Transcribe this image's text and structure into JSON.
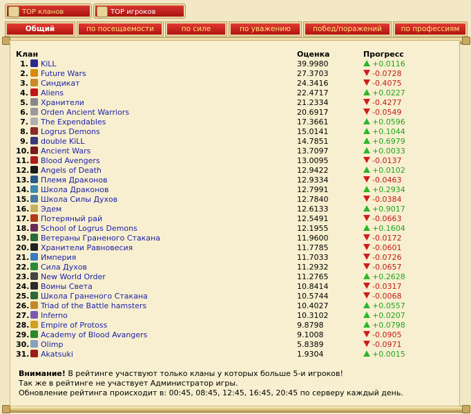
{
  "top_tabs": [
    {
      "label": "TOP кланов",
      "active": true
    },
    {
      "label": "TOP игроков",
      "active": false
    }
  ],
  "sub_tabs": [
    {
      "label": "Общий",
      "active": true
    },
    {
      "label": "по посещаемости",
      "active": false
    },
    {
      "label": "по силе",
      "active": false
    },
    {
      "label": "по уважению",
      "active": false
    },
    {
      "label": "побед/поражений",
      "active": false
    },
    {
      "label": "по профессиям",
      "active": false
    }
  ],
  "table": {
    "headers": {
      "clan": "Клан",
      "score": "Оценка",
      "progress": "Прогресс"
    },
    "rows": [
      {
        "rank": "1.",
        "name": "KiLL",
        "score": "39.9980",
        "progress": "+0.0116",
        "dir": "up",
        "icon_color": "#2b2b8f"
      },
      {
        "rank": "2.",
        "name": "Future Wars",
        "score": "27.3703",
        "progress": "-0.0728",
        "dir": "down",
        "icon_color": "#d98a10"
      },
      {
        "rank": "3.",
        "name": "Синдикат",
        "score": "24.3416",
        "progress": "-0.4075",
        "dir": "down",
        "icon_color": "#c98a2a"
      },
      {
        "rank": "4.",
        "name": "Aliens",
        "score": "22.4717",
        "progress": "+0.0227",
        "dir": "up",
        "icon_color": "#c01818"
      },
      {
        "rank": "5.",
        "name": "Хранители",
        "score": "21.2334",
        "progress": "-0.4277",
        "dir": "down",
        "icon_color": "#888888"
      },
      {
        "rank": "6.",
        "name": "Orden Ancient Warriors",
        "score": "20.6917",
        "progress": "-0.0549",
        "dir": "down",
        "icon_color": "#9a9a9a"
      },
      {
        "rank": "7.",
        "name": "The Expendables",
        "score": "17.3661",
        "progress": "+0.0596",
        "dir": "up",
        "icon_color": "#b0b0b0"
      },
      {
        "rank": "8.",
        "name": "Logrus Demons",
        "score": "15.0141",
        "progress": "+0.1044",
        "dir": "up",
        "icon_color": "#8a2a2a"
      },
      {
        "rank": "9.",
        "name": "double KiLL",
        "score": "14.7851",
        "progress": "+0.6979",
        "dir": "up",
        "icon_color": "#3a3a7a"
      },
      {
        "rank": "10.",
        "name": "Ancient Wars",
        "score": "13.7097",
        "progress": "+0.0033",
        "dir": "up",
        "icon_color": "#7a1a1a"
      },
      {
        "rank": "11.",
        "name": "Blood Avengers",
        "score": "13.0095",
        "progress": "-0.0137",
        "dir": "down",
        "icon_color": "#b01c1c"
      },
      {
        "rank": "12.",
        "name": "Angels of Death",
        "score": "12.9422",
        "progress": "+0.0102",
        "dir": "up",
        "icon_color": "#1a1a1a"
      },
      {
        "rank": "13.",
        "name": "Племя Драконов",
        "score": "12.9334",
        "progress": "-0.0463",
        "dir": "down",
        "icon_color": "#2a5a8a"
      },
      {
        "rank": "14.",
        "name": "Школа Драконов",
        "score": "12.7991",
        "progress": "+0.2934",
        "dir": "up",
        "icon_color": "#3a8ab0"
      },
      {
        "rank": "15.",
        "name": "Школа Силы Духов",
        "score": "12.7840",
        "progress": "-0.0384",
        "dir": "down",
        "icon_color": "#4a7aa0"
      },
      {
        "rank": "16.",
        "name": "Эдем",
        "score": "12.6133",
        "progress": "+0.9017",
        "dir": "up",
        "icon_color": "#c9b060"
      },
      {
        "rank": "17.",
        "name": "Потеряный рай",
        "score": "12.5491",
        "progress": "-0.0663",
        "dir": "down",
        "icon_color": "#b03a1a"
      },
      {
        "rank": "18.",
        "name": "School of Logrus Demons",
        "score": "12.1955",
        "progress": "+0.1604",
        "dir": "up",
        "icon_color": "#6a2a5a"
      },
      {
        "rank": "19.",
        "name": "Ветераны Граненого Стакана",
        "score": "11.9600",
        "progress": "-0.0172",
        "dir": "down",
        "icon_color": "#2a6a3a"
      },
      {
        "rank": "20.",
        "name": "Хранители Равновесия",
        "score": "11.7785",
        "progress": "-0.0601",
        "dir": "down",
        "icon_color": "#222222"
      },
      {
        "rank": "21.",
        "name": "Империя",
        "score": "11.7033",
        "progress": "-0.0726",
        "dir": "down",
        "icon_color": "#3a7ac0"
      },
      {
        "rank": "22.",
        "name": "Сила Духов",
        "score": "11.2932",
        "progress": "-0.0657",
        "dir": "down",
        "icon_color": "#2a8a3a"
      },
      {
        "rank": "23.",
        "name": "New World Order",
        "score": "11.2765",
        "progress": "+0.2628",
        "dir": "up",
        "icon_color": "#444444"
      },
      {
        "rank": "24.",
        "name": "Воины Света",
        "score": "10.8414",
        "progress": "-0.0317",
        "dir": "down",
        "icon_color": "#2a2a2a"
      },
      {
        "rank": "25.",
        "name": "Школа Граненого Стакана",
        "score": "10.5744",
        "progress": "-0.0068",
        "dir": "down",
        "icon_color": "#2a6a3a"
      },
      {
        "rank": "26.",
        "name": "Triad of the Battle hamsters",
        "score": "10.4027",
        "progress": "+0.0557",
        "dir": "up",
        "icon_color": "#c08a2a"
      },
      {
        "rank": "27.",
        "name": "Inferno",
        "score": "10.3102",
        "progress": "+0.0207",
        "dir": "up",
        "icon_color": "#7a5ab0"
      },
      {
        "rank": "28.",
        "name": "Empire of Protoss",
        "score": "9.8798",
        "progress": "+0.0798",
        "dir": "up",
        "icon_color": "#d0a020"
      },
      {
        "rank": "29.",
        "name": "Academy of Blood Avangers",
        "score": "9.1008",
        "progress": "-0.0905",
        "dir": "down",
        "icon_color": "#2a8a2a"
      },
      {
        "rank": "30.",
        "name": "Olimp",
        "score": "5.8389",
        "progress": "-0.0971",
        "dir": "down",
        "icon_color": "#8aa0c0"
      },
      {
        "rank": "31.",
        "name": "Akatsuki",
        "score": "1.9304",
        "progress": "+0.0015",
        "dir": "up",
        "icon_color": "#a01a1a"
      }
    ]
  },
  "notes": {
    "warning_label": "Внимание!",
    "line1": " В рейтинге участвуют только кланы у которых больше 5-и игроков!",
    "line2": "Так же в рейтинге не участвует Администратор игры.",
    "line3": "Обновление рейтинга происходит в: 00:45, 08:45, 12:45, 16:45, 20:45 по серверу каждый день."
  },
  "colors": {
    "up": "#1fa51f",
    "down": "#c21a1a",
    "link": "#1b1fa8"
  }
}
